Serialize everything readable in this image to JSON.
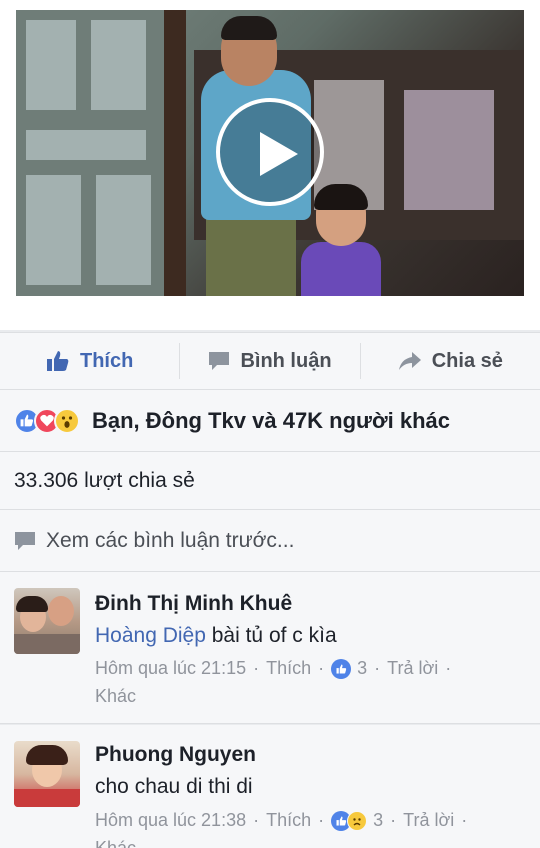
{
  "post": {
    "video": {
      "play_icon": "play-icon"
    }
  },
  "actions": {
    "like_label": "Thích",
    "comment_label": "Bình luận",
    "share_label": "Chia sẻ"
  },
  "reactions": {
    "icons": [
      "like-icon",
      "love-icon",
      "wow-icon"
    ],
    "summary": "Bạn, Đông Tkv và 47K người khác"
  },
  "shares": {
    "text": "33.306 lượt chia sẻ"
  },
  "previous_comments": {
    "label": "Xem các bình luận trước..."
  },
  "comments": [
    {
      "author": "Đinh Thị Minh Khuê",
      "tag": "Hoàng Diệp",
      "text": " bài tủ of c kìa",
      "time": "Hôm qua lúc 21:15",
      "like_label": "Thích",
      "reaction_count": "3",
      "reply_label": "Trả lời",
      "more_label": "Khác"
    },
    {
      "author": "Phuong Nguyen",
      "text": "cho chau di thi di",
      "time": "Hôm qua lúc 21:38",
      "like_label": "Thích",
      "reaction_count": "3",
      "reply_label": "Trả lời",
      "more_label": "Khác"
    }
  ],
  "colors": {
    "accent": "#4267b2",
    "background": "#e9ebee",
    "row_background": "#f6f7f9",
    "meta_text": "#90949c"
  }
}
